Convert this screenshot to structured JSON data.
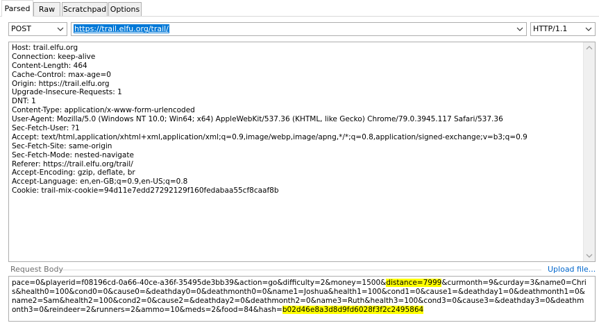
{
  "tabs": [
    {
      "label": "Parsed"
    },
    {
      "label": "Raw"
    },
    {
      "label": "Scratchpad"
    },
    {
      "label": "Options"
    }
  ],
  "request": {
    "method": "POST",
    "url": "https://trail.elfu.org/trail/",
    "protocol": "HTTP/1.1"
  },
  "headers": [
    "Host: trail.elfu.org",
    "Connection: keep-alive",
    "Content-Length: 464",
    "Cache-Control: max-age=0",
    "Origin: https://trail.elfu.org",
    "Upgrade-Insecure-Requests: 1",
    "DNT: 1",
    "Content-Type: application/x-www-form-urlencoded",
    "User-Agent: Mozilla/5.0 (Windows NT 10.0; Win64; x64) AppleWebKit/537.36 (KHTML, like Gecko) Chrome/79.0.3945.117 Safari/537.36",
    "Sec-Fetch-User: ?1",
    "Accept: text/html,application/xhtml+xml,application/xml;q=0.9,image/webp,image/apng,*/*;q=0.8,application/signed-exchange;v=b3;q=0.9",
    "Sec-Fetch-Site: same-origin",
    "Sec-Fetch-Mode: nested-navigate",
    "Referer: https://trail.elfu.org/trail/",
    "Accept-Encoding: gzip, deflate, br",
    "Accept-Language: en,en-GB;q=0.9,en-US;q=0.8",
    "Cookie: trail-mix-cookie=94d11e7edd27292129f160fedabaa55cf8caaf8b"
  ],
  "request_body": {
    "label": "Request Body",
    "upload_link": "Upload file...",
    "seg1": "pace=0&playerid=f08196cd-0a66-40ce-a36f-35495de3bb39&action=go&difficulty=2&money=1500&",
    "hl1": "distance=7999",
    "seg2": "&curmonth=9&curday=3&name0=Chris&health0=100&cond0=0&cause0=&deathday0=0&deathmonth0=0&name1=Joshua&health1=100&cond1=0&cause1=&deathday1=0&deathmonth1=0&name2=Sam&health2=100&cond2=0&cause2=&deathday2=0&deathmonth2=0&name3=Ruth&health3=100&cond3=0&cause3=&deathday3=0&deathmonth3=0&reindeer=2&runners=2&ammo=10&meds=2&food=84&hash=",
    "hl2": "b02d46e8a3d8d9fd6028f3f2c2495864"
  }
}
